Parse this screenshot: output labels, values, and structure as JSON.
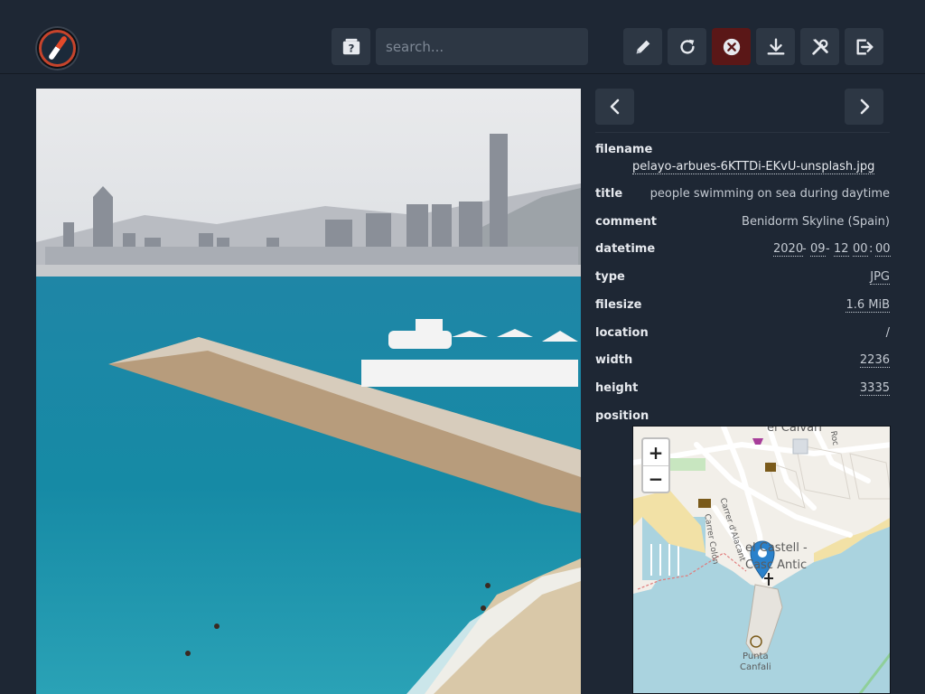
{
  "header": {
    "logo": "compass-logo",
    "search_placeholder": "search...",
    "buttons": [
      {
        "name": "random-image-button",
        "icon": "random-question-icon"
      },
      {
        "name": "edit-button",
        "icon": "pencil-icon"
      },
      {
        "name": "refresh-button",
        "icon": "refresh-icon"
      },
      {
        "name": "close-button",
        "icon": "close-circle-icon"
      },
      {
        "name": "download-button",
        "icon": "download-icon"
      },
      {
        "name": "tools-button",
        "icon": "tools-icon"
      },
      {
        "name": "logout-button",
        "icon": "logout-icon"
      }
    ]
  },
  "photo": {
    "subject": "Benidorm skyline seen from the harbour jetty"
  },
  "details": {
    "filename_label": "filename",
    "filename": "pelayo-arbues-6KTTDi-EKvU-unsplash.jpg",
    "title_label": "title",
    "title": "people swimming on sea during daytime",
    "comment_label": "comment",
    "comment": "Benidorm Skyline (Spain)",
    "datetime_label": "datetime",
    "date_year": "2020",
    "date_month": "09",
    "date_day": "12",
    "time_hour": "00",
    "time_minute": "00",
    "sep_dash": "-",
    "sep_colon": ":",
    "type_label": "type",
    "type": "JPG",
    "filesize_label": "filesize",
    "filesize": "1.6 MiB",
    "location_label": "location",
    "location": "/",
    "width_label": "width",
    "width": "2236",
    "height_label": "height",
    "height": "3335",
    "position_label": "position"
  },
  "map": {
    "zoom_in": "+",
    "zoom_out": "−",
    "labels": {
      "calvari": "el Calvari",
      "roc": "Roc",
      "alacant": "Carrer d'Alacant",
      "colon": "Carrer Colón",
      "castell_1": "el Castell -",
      "castell_2": "Casc Antic",
      "punta": "Punta",
      "canfali": "Canfali"
    }
  },
  "colors": {
    "background": "#1e2734",
    "button": "#2d3744",
    "danger": "#5a1717",
    "marker": "#2a81cb",
    "sea": "#aad3df"
  }
}
